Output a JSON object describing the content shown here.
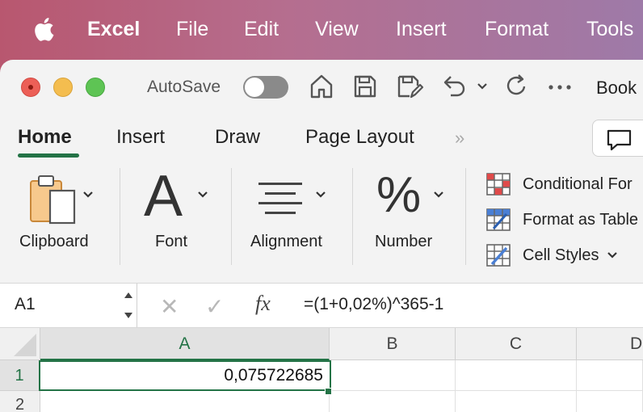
{
  "menubar": {
    "app_name": "Excel",
    "items": [
      "File",
      "Edit",
      "View",
      "Insert",
      "Format",
      "Tools"
    ]
  },
  "titlebar": {
    "autosave_label": "AutoSave",
    "autosave_on": false,
    "doc_title": "Book"
  },
  "tabs": {
    "items": [
      "Home",
      "Insert",
      "Draw",
      "Page Layout"
    ],
    "active": "Home",
    "more": "»"
  },
  "ribbon": {
    "clipboard_label": "Clipboard",
    "font_label": "Font",
    "font_glyph": "A",
    "alignment_label": "Alignment",
    "number_label": "Number",
    "number_glyph": "%",
    "styles": {
      "conditional": "Conditional For",
      "format_table": "Format as Table",
      "cell_styles": "Cell Styles"
    }
  },
  "formula_bar": {
    "name_box": "A1",
    "formula": "=(1+0,02%)^365-1",
    "fx": "fx",
    "cancel": "✕",
    "enter": "✓"
  },
  "grid": {
    "columns": [
      "A",
      "B",
      "C",
      "D"
    ],
    "rows": [
      "1",
      "2"
    ],
    "a1_value": "0,075722685"
  },
  "colors": {
    "accent": "#237346",
    "menubar_start": "#b8576f",
    "menubar_end": "#9e7aa8"
  }
}
